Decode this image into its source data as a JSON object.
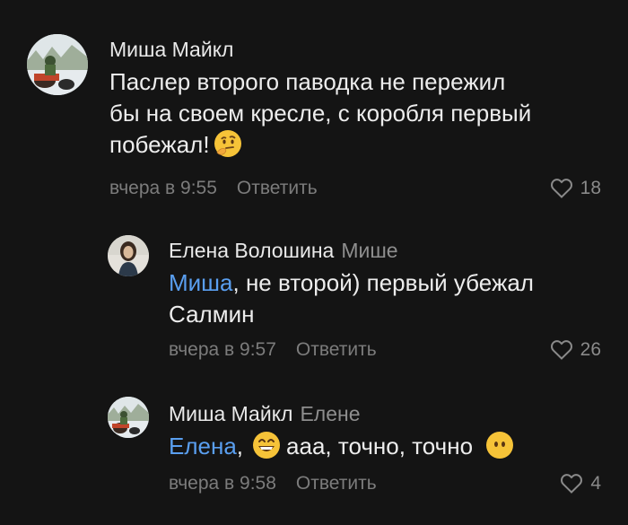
{
  "comments": [
    {
      "author": "Миша Майкл",
      "avatar": "atv-rider-avatar",
      "text_lines": [
        "Паслер второго паводка не пережил",
        "бы на своем кресле, с коробля первый",
        "побежал!"
      ],
      "emoji": "thinking-face",
      "time": "вчера в 9:55",
      "reply_label": "Ответить",
      "likes": "18"
    },
    {
      "author": "Елена Волошина",
      "reply_to": "Мише",
      "avatar": "woman-avatar",
      "mention": "Миша",
      "text_line1_rest": ", не второй) первый убежал",
      "text_line2": "Салмин",
      "time": "вчера в 9:57",
      "reply_label": "Ответить",
      "likes": "26"
    },
    {
      "author": "Миша Майкл",
      "reply_to": "Елене",
      "avatar": "atv-rider-avatar",
      "mention": "Елена",
      "text_sep": ",",
      "text_rest": "ааа, точно, точно",
      "emoji_1": "grinning-face",
      "emoji_2": "face-without-mouth",
      "time": "вчера в 9:58",
      "reply_label": "Ответить",
      "likes": "4"
    }
  ],
  "colors": {
    "background": "#141414",
    "mention": "#5a9ff0",
    "secondary_text": "#7c7c7c"
  }
}
